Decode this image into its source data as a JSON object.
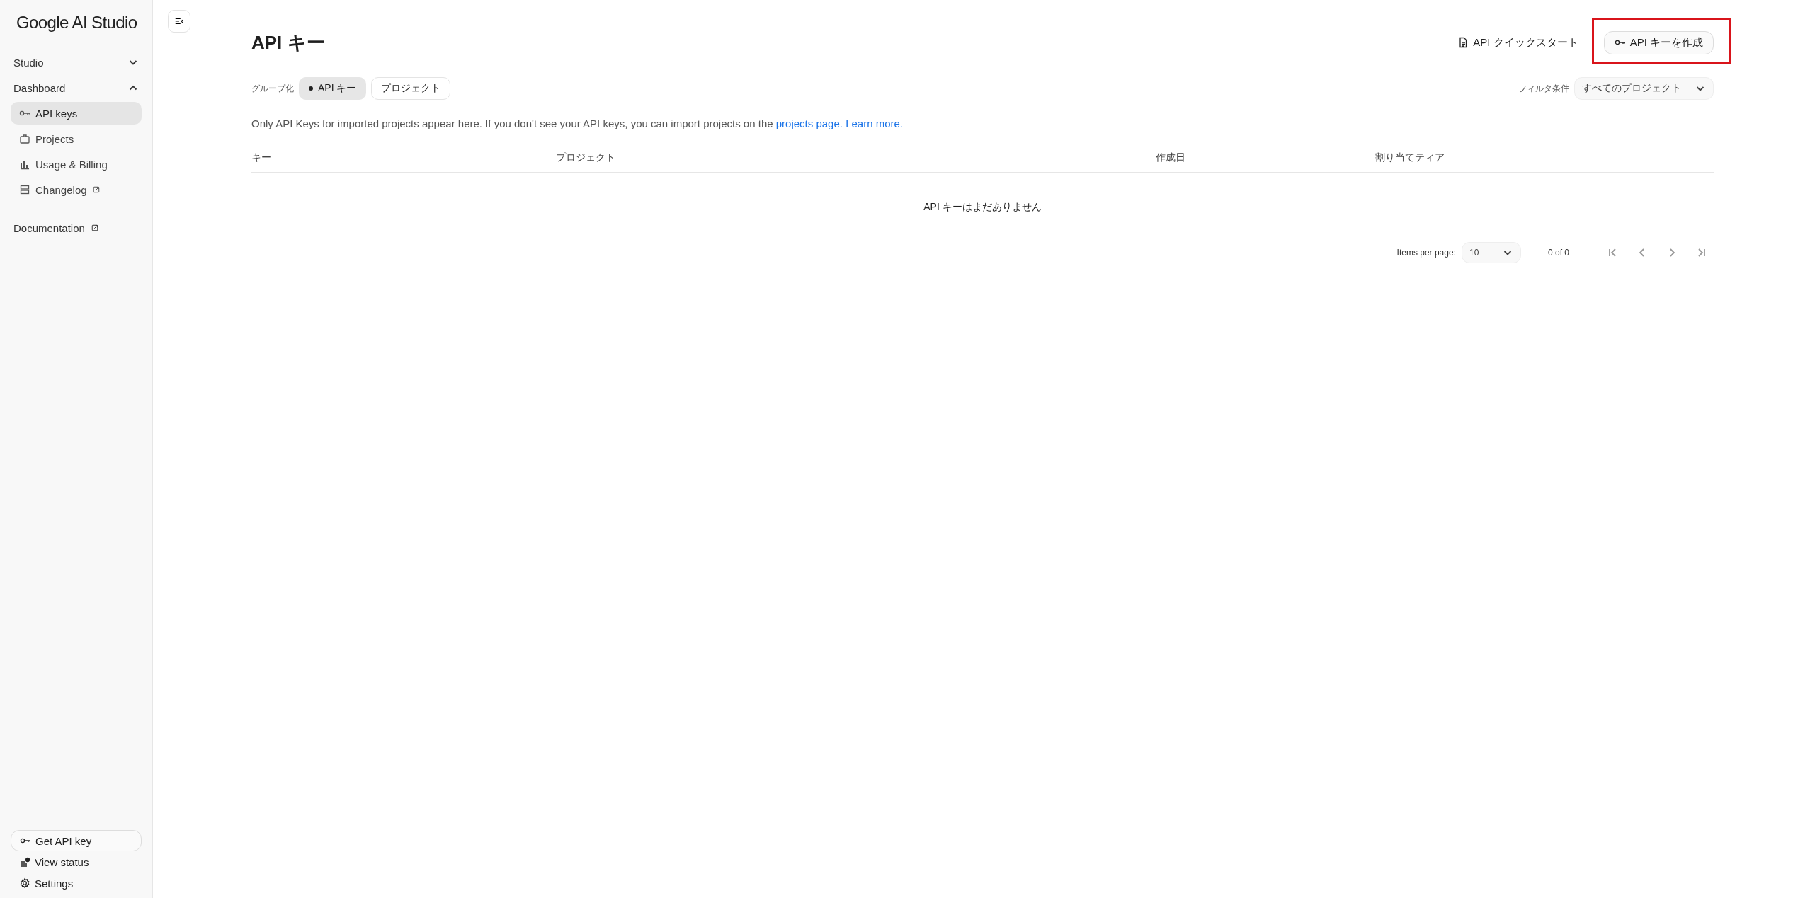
{
  "sidebar": {
    "logo": "Google AI Studio",
    "sections": [
      {
        "label": "Studio",
        "expanded": false
      },
      {
        "label": "Dashboard",
        "expanded": true,
        "children": [
          {
            "label": "API keys",
            "selected": true,
            "external": false
          },
          {
            "label": "Projects",
            "selected": false,
            "external": false
          },
          {
            "label": "Usage & Billing",
            "selected": false,
            "external": false
          },
          {
            "label": "Changelog",
            "selected": false,
            "external": true
          }
        ]
      }
    ],
    "documentation": {
      "label": "Documentation",
      "external": true
    },
    "footer": [
      {
        "label": "Get API key",
        "kind": "pill"
      },
      {
        "label": "View status",
        "kind": "plain"
      },
      {
        "label": "Settings",
        "kind": "plain"
      }
    ]
  },
  "page": {
    "title": "API キー",
    "quickstart": "API クイックスタート",
    "create_button": {
      "label": "API キーを作成",
      "highlighted": true
    },
    "group_by": {
      "label": "グループ化",
      "options": [
        {
          "label": "API キー",
          "selected": true
        },
        {
          "label": "プロジェクト",
          "selected": false
        }
      ]
    },
    "filter": {
      "label": "フィルタ条件",
      "value": "すべてのプロジェクト"
    },
    "notice": {
      "text": "Only API Keys for imported projects appear here. If you don't see your API keys, you can import projects on the ",
      "links": [
        "projects page.",
        "Learn more."
      ]
    },
    "table": {
      "columns": [
        "キー",
        "プロジェクト",
        "作成日",
        "割り当てティア"
      ],
      "empty": "API キーはまだありません"
    },
    "pagination": {
      "label": "Items per page:",
      "per_page": "10",
      "range": "0 of 0",
      "buttons": [
        {
          "disabled": true
        },
        {
          "disabled": true
        },
        {
          "disabled": true
        },
        {
          "disabled": true
        }
      ]
    }
  }
}
